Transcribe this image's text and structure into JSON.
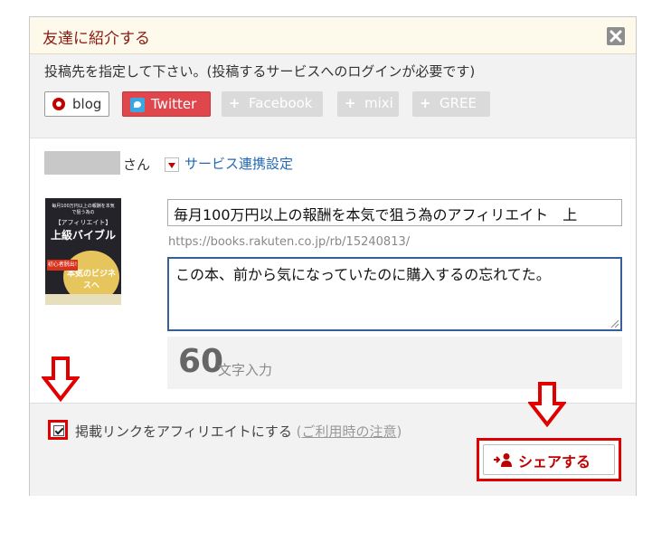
{
  "dialog": {
    "title": "友達に紹介する",
    "instruction": "投稿先を指定して下さい。(投稿するサービスへのログインが必要です)",
    "services": {
      "blog": "blog",
      "twitter": "Twitter",
      "facebook": "Facebook",
      "mixi": "mixi",
      "gree": "GREE",
      "plus": "+"
    },
    "user": {
      "suffix": "さん",
      "service_settings": "サービス連携設定"
    },
    "book": {
      "cover_line1": "毎月100万円以上の報酬を本気で狙う為の",
      "cover_line2": "【アフィリエイト】",
      "cover_title": "上級バイブル",
      "cover_circle": "本気のビジネスへ",
      "cover_tag": "初心者脱出!",
      "title_value": "毎月100万円以上の報酬を本気で狙う為のアフィリエイト　上",
      "url": "https://books.rakuten.co.jp/rb/15240813/"
    },
    "comment": {
      "value": "この本、前から気になっていたのに購入するの忘れてた。"
    },
    "counter": {
      "count": "60",
      "label": "文字入力"
    },
    "footer": {
      "checkbox_label": "掲載リンクをアフィリエイトにする",
      "note_open": "(",
      "note_link": "ご利用時の注意",
      "note_close": ")",
      "share_label": "シェアする"
    }
  },
  "colors": {
    "accent_red": "#e00000",
    "title_red": "#8a1a12",
    "twitter_bg": "#e0474c",
    "link_blue": "#2168b5"
  }
}
